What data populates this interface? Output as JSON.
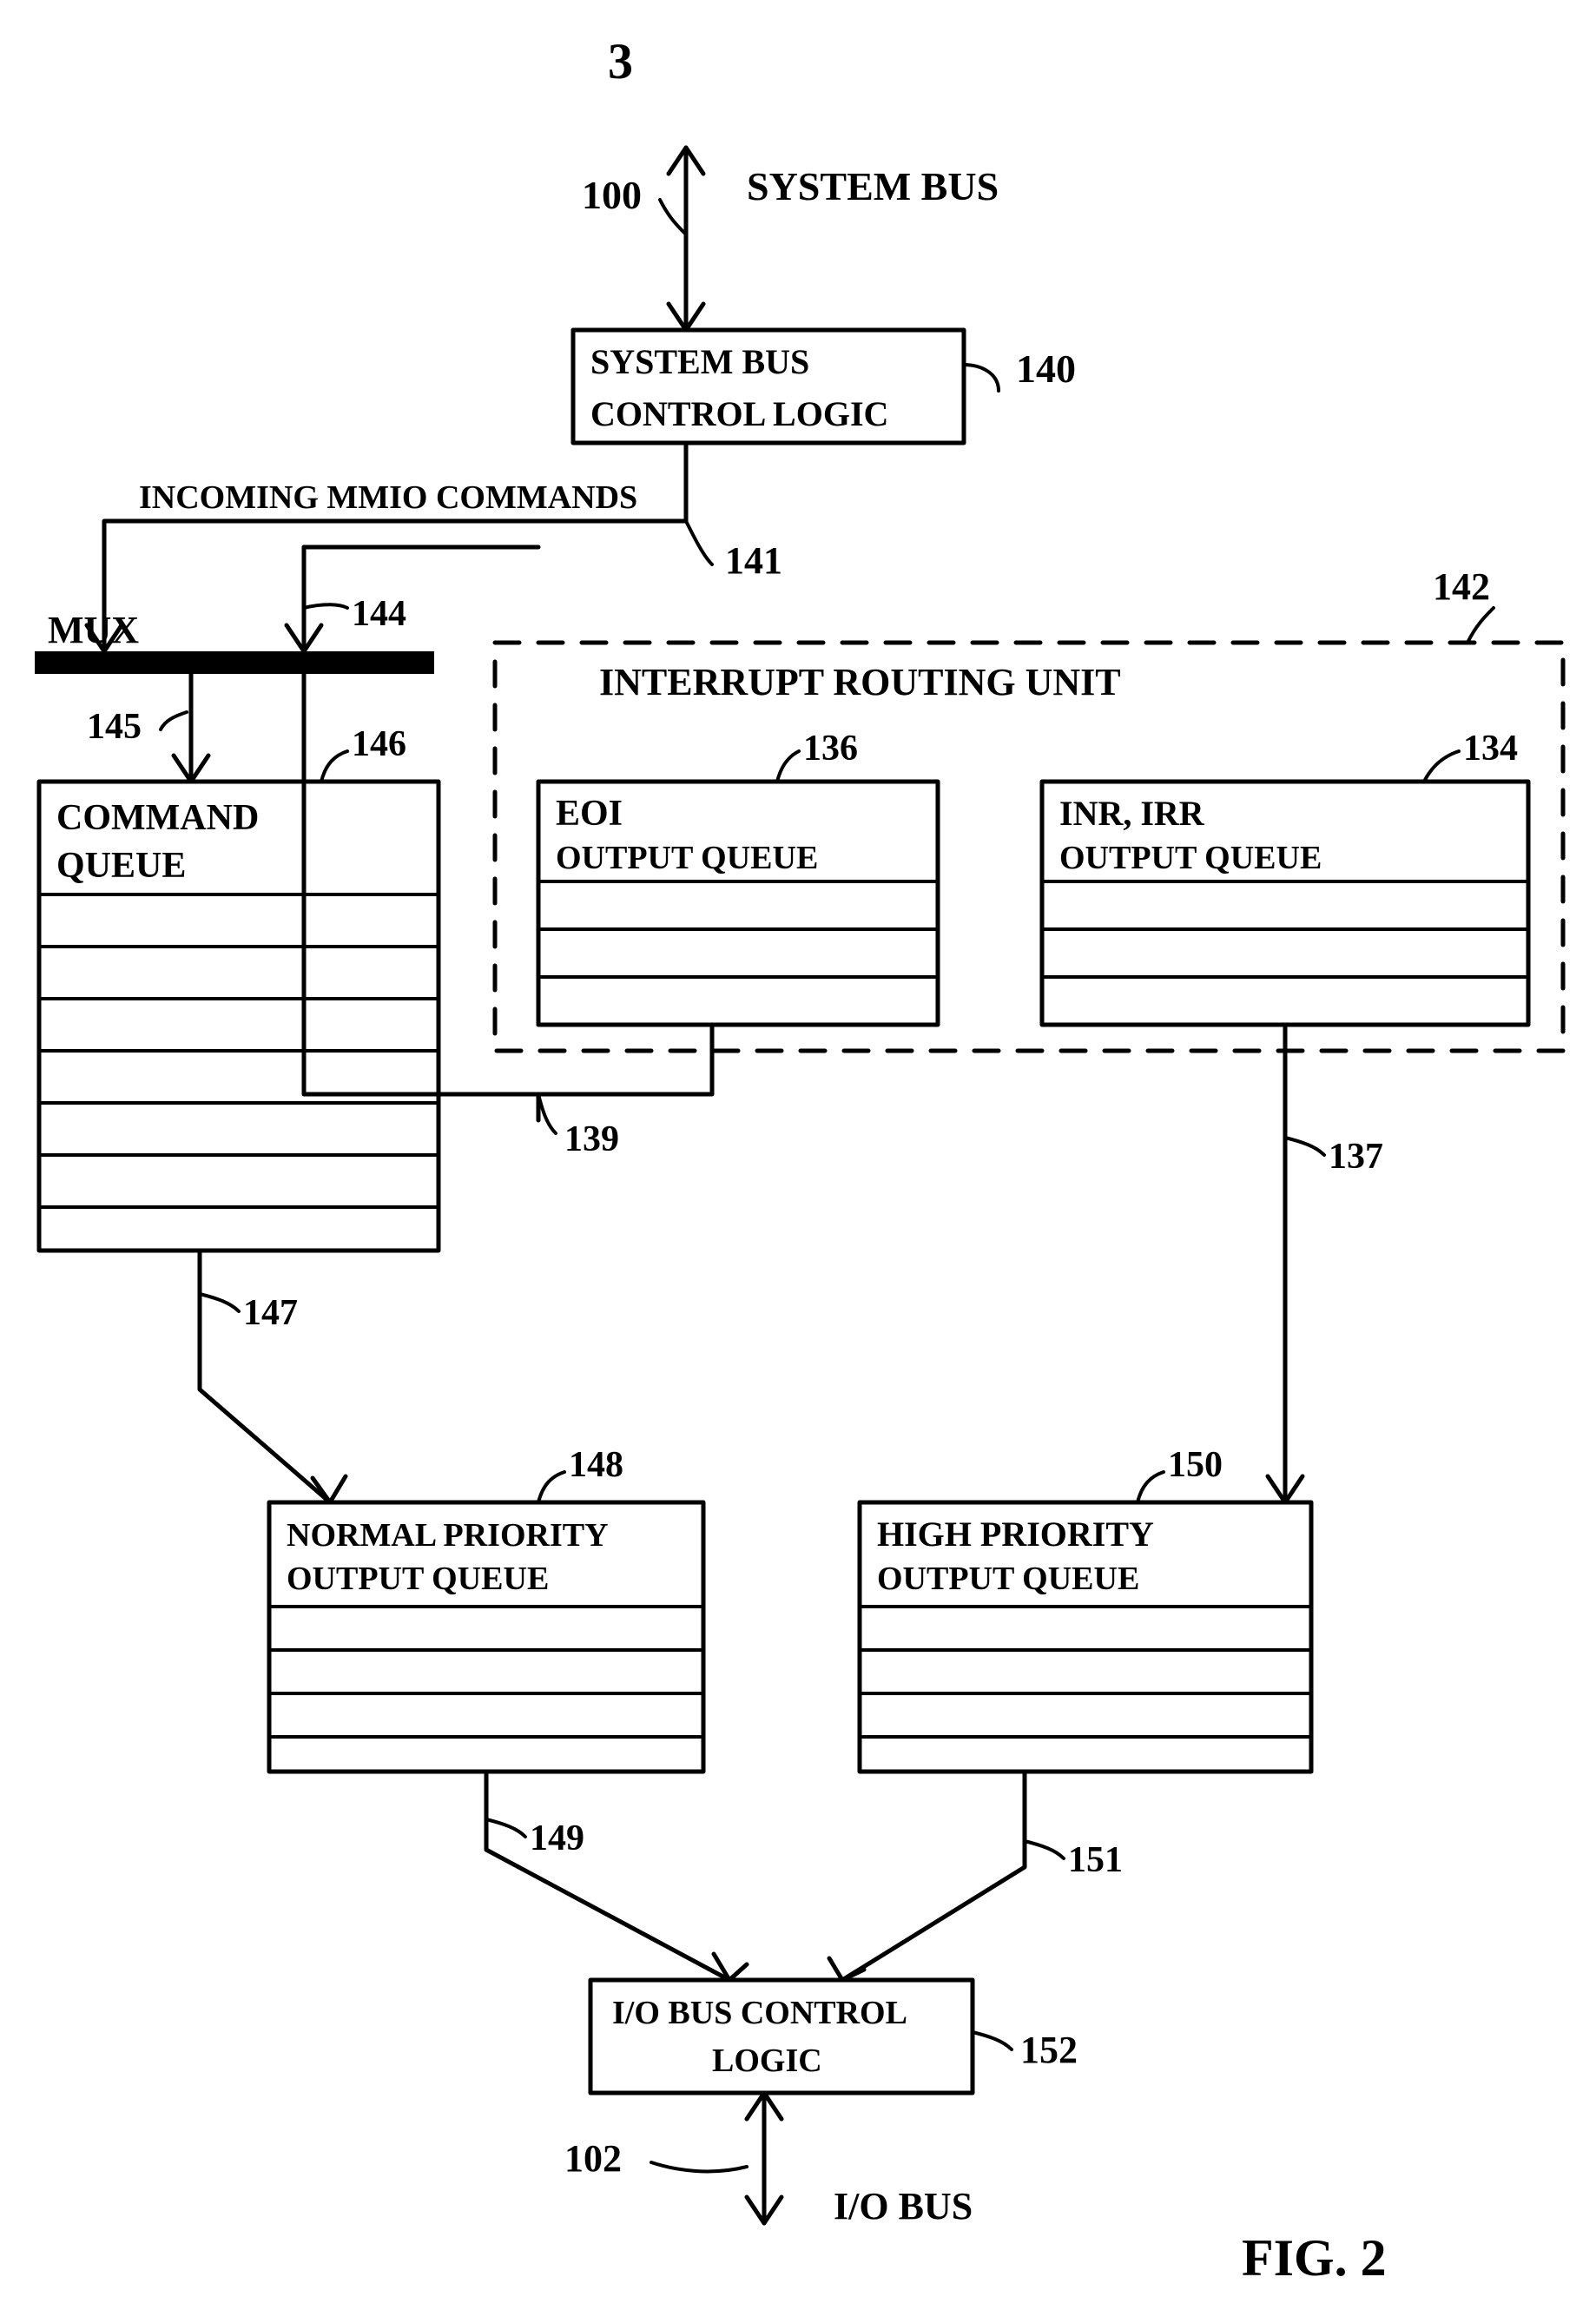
{
  "page_number": "3",
  "figure_label": "FIG. 2",
  "labels": {
    "system_bus": "SYSTEM  BUS",
    "incoming": "INCOMING MMIO COMMANDS",
    "mux": "MUX",
    "interrupt_unit": "INTERRUPT   ROUTING   UNIT",
    "io_bus": "I/O  BUS"
  },
  "refs": {
    "r100": "100",
    "r140": "140",
    "r141": "141",
    "r142": "142",
    "r144": "144",
    "r145": "145",
    "r146": "146",
    "r147": "147",
    "r136": "136",
    "r134": "134",
    "r139": "139",
    "r137": "137",
    "r148": "148",
    "r150": "150",
    "r149": "149",
    "r151": "151",
    "r152": "152",
    "r102": "102"
  },
  "blocks": {
    "sys_bus_ctrl_l1": "SYSTEM  BUS",
    "sys_bus_ctrl_l2": "CONTROL  LOGIC",
    "cmd_q_l1": "COMMAND",
    "cmd_q_l2": "QUEUE",
    "eoi_l1": "EOI",
    "eoi_l2": "OUTPUT QUEUE",
    "inr_l1": "INR, IRR",
    "inr_l2": "OUTPUT QUEUE",
    "norm_l1": "NORMAL PRIORITY",
    "norm_l2": "OUTPUT QUEUE",
    "high_l1": "HIGH PRIORITY",
    "high_l2": "OUTPUT QUEUE",
    "io_ctrl_l1": "I/O BUS CONTROL",
    "io_ctrl_l2": "LOGIC"
  }
}
